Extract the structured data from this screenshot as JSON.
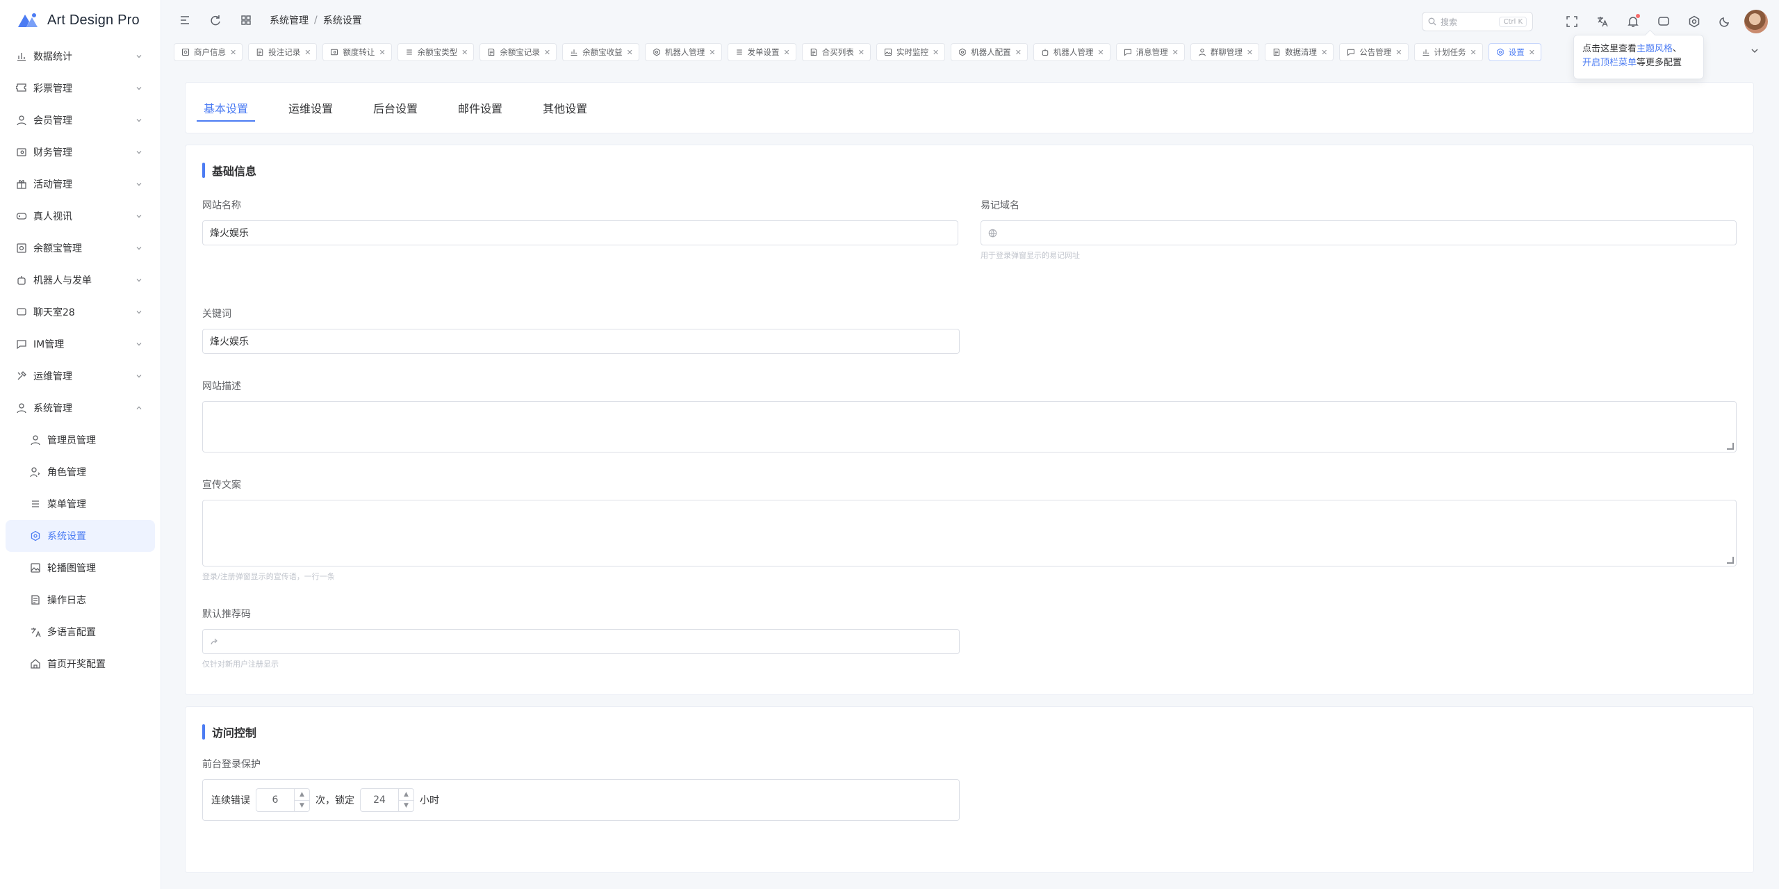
{
  "app": {
    "title": "Art Design Pro"
  },
  "sidebar": {
    "items": [
      {
        "label": "数据统计",
        "icon": "chart-icon"
      },
      {
        "label": "彩票管理",
        "icon": "ticket-icon"
      },
      {
        "label": "会员管理",
        "icon": "user-icon"
      },
      {
        "label": "财务管理",
        "icon": "wallet-icon"
      },
      {
        "label": "活动管理",
        "icon": "gift-icon"
      },
      {
        "label": "真人视讯",
        "icon": "gamepad-icon"
      },
      {
        "label": "余额宝管理",
        "icon": "safe-icon"
      },
      {
        "label": "机器人与发单",
        "icon": "robot-icon"
      },
      {
        "label": "聊天室28",
        "icon": "chat-icon"
      },
      {
        "label": "IM管理",
        "icon": "message-icon"
      },
      {
        "label": "运维管理",
        "icon": "tools-icon"
      },
      {
        "label": "系统管理",
        "icon": "user-icon"
      }
    ],
    "submenu": [
      {
        "label": "管理员管理",
        "icon": "user-icon"
      },
      {
        "label": "角色管理",
        "icon": "role-icon"
      },
      {
        "label": "菜单管理",
        "icon": "list-icon"
      },
      {
        "label": "系统设置",
        "icon": "gear-icon"
      },
      {
        "label": "轮播图管理",
        "icon": "image-icon"
      },
      {
        "label": "操作日志",
        "icon": "log-icon"
      },
      {
        "label": "多语言配置",
        "icon": "translate-icon"
      },
      {
        "label": "首页开奖配置",
        "icon": "home-icon"
      }
    ]
  },
  "header": {
    "breadcrumb": [
      "系统管理",
      "系统设置"
    ],
    "search_placeholder": "搜索",
    "search_kbd": "Ctrl K"
  },
  "tabs": [
    {
      "label": "商户信息"
    },
    {
      "label": "投注记录"
    },
    {
      "label": "额度转让"
    },
    {
      "label": "余额宝类型"
    },
    {
      "label": "余额宝记录"
    },
    {
      "label": "余额宝收益"
    },
    {
      "label": "机器人管理"
    },
    {
      "label": "发单设置"
    },
    {
      "label": "合买列表"
    },
    {
      "label": "实时监控"
    },
    {
      "label": "机器人配置"
    },
    {
      "label": "机器人管理"
    },
    {
      "label": "消息管理"
    },
    {
      "label": "群聊管理"
    },
    {
      "label": "数据清理"
    },
    {
      "label": "公告管理"
    },
    {
      "label": "计划任务"
    },
    {
      "label": "设置"
    }
  ],
  "tooltip": {
    "prefix": "点击这里查看",
    "link1": "主题风格",
    "sep": "、",
    "link2": "开启顶栏菜单",
    "suffix": "等更多配置"
  },
  "settings": {
    "tabs": [
      "基本设置",
      "运维设置",
      "后台设置",
      "邮件设置",
      "其他设置"
    ],
    "basic": {
      "title": "基础信息",
      "site_name_label": "网站名称",
      "site_name_value": "烽火娱乐",
      "domain_label": "易记域名",
      "domain_hint": "用于登录弹窗显示的易记网址",
      "keywords_label": "关键词",
      "keywords_value": "烽火娱乐",
      "desc_label": "网站描述",
      "promo_label": "宣传文案",
      "promo_hint": "登录/注册弹窗显示的宣传语，一行一条",
      "ref_label": "默认推荐码",
      "ref_hint": "仅针对新用户注册显示"
    },
    "access": {
      "title": "访问控制",
      "login_label": "前台登录保护",
      "err_prefix": "连续错误",
      "err_count": "6",
      "err_unit": "次，锁定",
      "lock_hours": "24",
      "lock_unit": "小时"
    }
  }
}
